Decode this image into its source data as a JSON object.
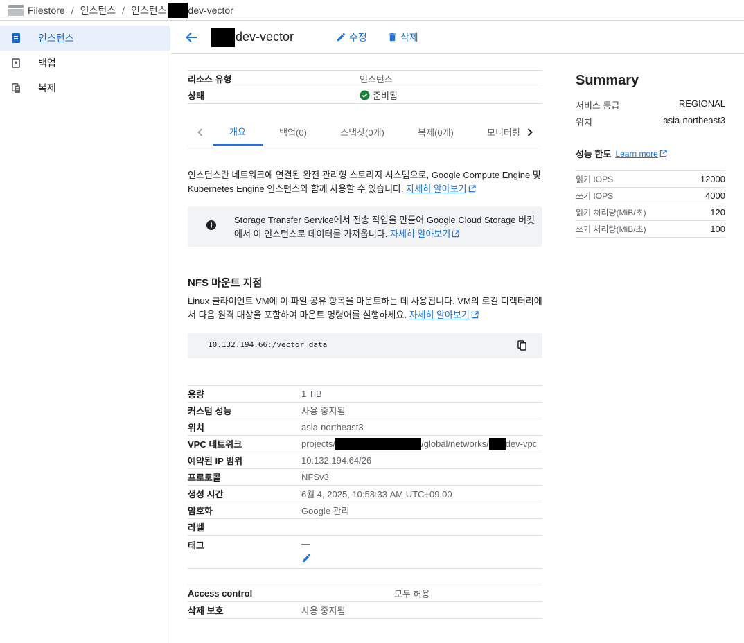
{
  "breadcrumb": {
    "items": [
      "Filestore",
      "인스턴스",
      "인스턴스:",
      "dev-vector"
    ]
  },
  "sidebar": {
    "items": [
      {
        "label": "인스턴스",
        "icon": "instance-icon",
        "active": true
      },
      {
        "label": "백업",
        "icon": "backup-icon",
        "active": false
      },
      {
        "label": "복제",
        "icon": "replication-icon",
        "active": false
      }
    ]
  },
  "header": {
    "title": "dev-vector",
    "edit_label": "수정",
    "delete_label": "삭제"
  },
  "basic": {
    "type_key": "리소스 유형",
    "type_value": "인스턴스",
    "status_key": "상태",
    "status_value": "준비됨"
  },
  "tabs": [
    "개요",
    "백업(0)",
    "스냅샷(0개)",
    "복제(0개)",
    "모니터링"
  ],
  "overview": {
    "desc": "인스턴스란 네트워크에 연결된 완전 관리형 스토리지 시스템으로, Google Compute Engine 및 Kubernetes Engine 인스턴스와 함께 사용할 수 있습니다.",
    "learn_more": "자세히 알아보기",
    "info": "Storage Transfer Service에서 전송 작업을 만들어 Google Cloud Storage 버킷에서 이 인스턴스로 데이터를 가져옵니다.",
    "info_link": "자세히 알아보기"
  },
  "nfs": {
    "title": "NFS 마운트 지점",
    "desc": "Linux 클라이언트 VM에 이 파일 공유 항목을 마운트하는 데 사용됩니다. VM의 로컬 디렉터리에서 다음 원격 대상을 포함하여 마운트 명령어를 실행하세요.",
    "link": "자세히 알아보기",
    "mount_point": "10.132.194.66:/vector_data"
  },
  "details": {
    "capacity_k": "용량",
    "capacity_v": "1 TiB",
    "perf_k": "커스텀 성능",
    "perf_v": "사용 중지됨",
    "loc_k": "위치",
    "loc_v": "asia-northeast3",
    "vpc_k": "VPC 네트워크",
    "vpc_prefix": "projects/",
    "vpc_mid": "/global/networks/",
    "vpc_suffix": "dev-vpc",
    "ip_k": "예약된 IP 범위",
    "ip_v": "10.132.194.64/26",
    "proto_k": "프로토콜",
    "proto_v": "NFSv3",
    "created_k": "생성 시간",
    "created_v": "6월 4, 2025, 10:58:33 AM UTC+09:00",
    "enc_k": "암호화",
    "enc_v": "Google 관리",
    "label_k": "라벨",
    "tag_k": "태그",
    "tag_v": "—",
    "access_k": "Access control",
    "access_v": "모두 허용",
    "delprot_k": "삭제 보호",
    "delprot_v": "사용 중지됨"
  },
  "summary": {
    "title": "Summary",
    "tier_k": "서비스 등급",
    "tier_v": "REGIONAL",
    "loc_k": "위치",
    "loc_v": "asia-northeast3",
    "limits_title": "성능 한도",
    "learn_more": "Learn more",
    "perf": [
      {
        "k": "읽기 IOPS",
        "v": "12000"
      },
      {
        "k": "쓰기 IOPS",
        "v": "4000"
      },
      {
        "k": "읽기 처리량(MiB/초)",
        "v": "120"
      },
      {
        "k": "쓰기 처리량(MiB/초)",
        "v": "100"
      }
    ]
  },
  "colors": {
    "accent": "#1a73e8",
    "active_nav_bg": "#e8f0fe",
    "success": "#188038",
    "redaction": "#000000"
  }
}
